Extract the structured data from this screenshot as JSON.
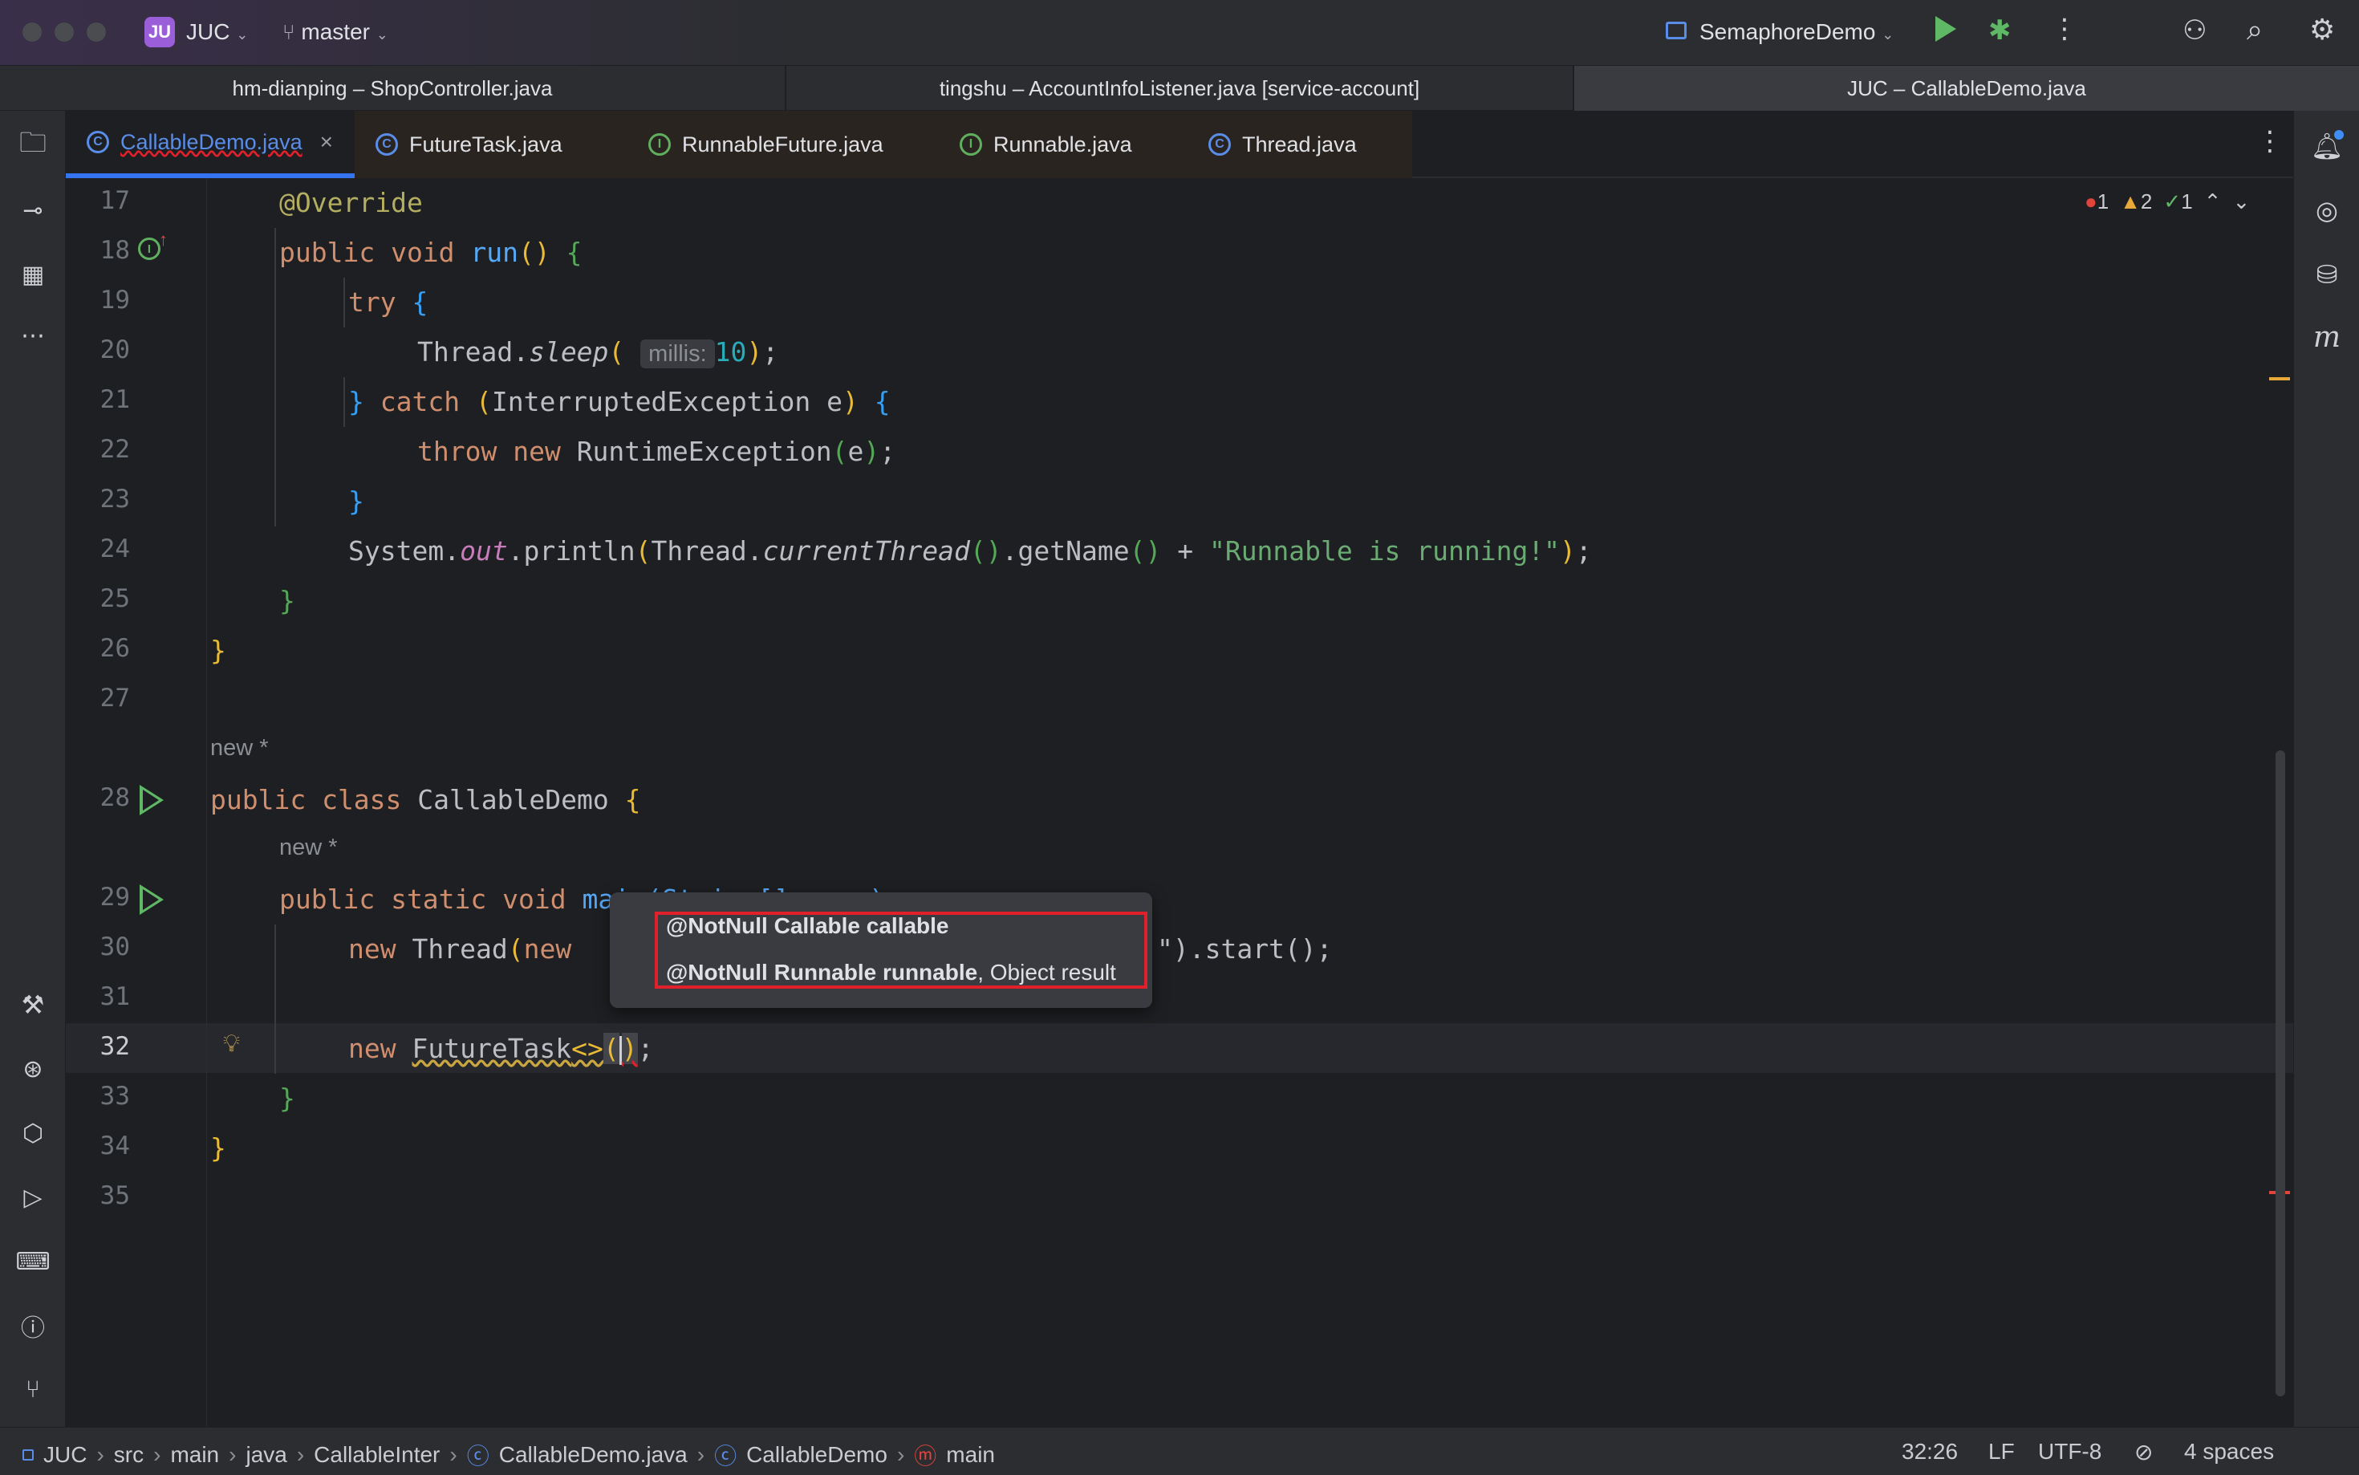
{
  "titlebar": {
    "project_badge": "JU",
    "project": "JUC",
    "branch": "master",
    "run_config": "SemaphoreDemo",
    "icons": [
      "run-icon",
      "debug-icon",
      "more-icon",
      "add-user-icon",
      "search-icon",
      "settings-icon"
    ]
  },
  "window_tabs": [
    {
      "label": "hm-dianping – ShopController.java"
    },
    {
      "label": "tingshu – AccountInfoListener.java [service-account]"
    },
    {
      "label": "JUC – CallableDemo.java"
    }
  ],
  "editor_tabs": [
    {
      "label": "CallableDemo.java",
      "kind": "class",
      "active": true
    },
    {
      "label": "FutureTask.java",
      "kind": "class"
    },
    {
      "label": "RunnableFuture.java",
      "kind": "interface"
    },
    {
      "label": "Runnable.java",
      "kind": "interface"
    },
    {
      "label": "Thread.java",
      "kind": "class"
    }
  ],
  "inspections": {
    "errors": "1",
    "warnings": "2",
    "ok": "1"
  },
  "line_numbers": [
    "17",
    "18",
    "19",
    "20",
    "21",
    "22",
    "23",
    "24",
    "25",
    "26",
    "27",
    "28",
    "29",
    "30",
    "31",
    "32",
    "33",
    "34",
    "35"
  ],
  "code": {
    "l17": "@Override",
    "l18_kw": "public void",
    "l18_fn": "run",
    "l19": "try",
    "l20_cls": "Thread.",
    "l20_m": "sleep",
    "l20_hint": "millis:",
    "l20_num": "10",
    "l21_kw": "catch",
    "l21_t": "InterruptedException e",
    "l22_kw": "throw new",
    "l22_t": "RuntimeException",
    "l22_arg": "e",
    "l24_a": "System.",
    "l24_out": "out",
    "l24_b": ".println",
    "l24_c": "Thread.",
    "l24_d": "currentThread",
    "l24_e": ".getName",
    "l24_plus": "+",
    "l24_str": "\"Runnable is running!\"",
    "new_label": "new *",
    "l28_kw": "public class",
    "l28_name": "CallableDemo",
    "l29_kw": "public static void",
    "l29_rest": "main(String[] args)",
    "l30_kw": "new",
    "l30_t": "Thread",
    "l30_kw2": "new",
    "l30_end": "\").start();",
    "l32_kw": "new",
    "l32_t": "FutureTask",
    "l32_gen": "<>"
  },
  "popup": {
    "item1_bold": "@NotNull Callable callable",
    "item2_bold": "@NotNull Runnable runnable",
    "item2_rest": ", Object result"
  },
  "status": {
    "crumbs": [
      "JUC",
      "src",
      "main",
      "java",
      "CallableInter",
      "CallableDemo.java",
      "CallableDemo",
      "main"
    ],
    "position": "32:26",
    "line_sep": "LF",
    "encoding": "UTF-8",
    "indent": "4 spaces"
  }
}
